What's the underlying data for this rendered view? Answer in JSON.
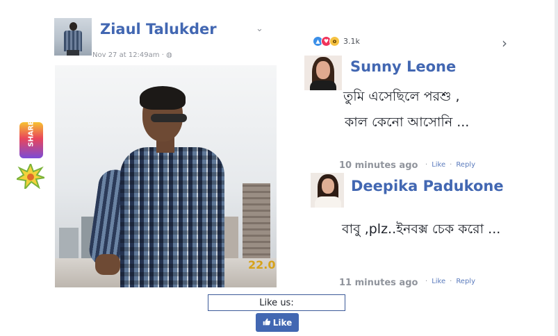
{
  "post": {
    "author": "Ziaul Talukder",
    "meta": "Nov 27 at 12:49am · ◍",
    "chevron": "⌄",
    "photo_stamp": "22.0"
  },
  "share_badge": {
    "label": "SHARE"
  },
  "reactions": {
    "count": "3.1k"
  },
  "comments": [
    {
      "name": "Sunny Leone",
      "lines": [
        "তুমি এসেছিলে পরশু ,",
        "কাল কেনো আসোনি   ..."
      ],
      "time": "10 minutes ago",
      "like": "Like",
      "reply": "Reply"
    },
    {
      "name": "Deepika Padukone",
      "lines": [
        "বাবু ,plz..ইনবক্স চেক করো ..."
      ],
      "time": "11 minutes ago",
      "like": "Like",
      "reply": "Reply"
    }
  ],
  "like_us": {
    "label": "Like us:"
  },
  "like_button": {
    "label": "Like"
  },
  "colors": {
    "link_blue": "#4267b2",
    "fb_blue": "#3b5998",
    "meta_gray": "#90949c"
  }
}
